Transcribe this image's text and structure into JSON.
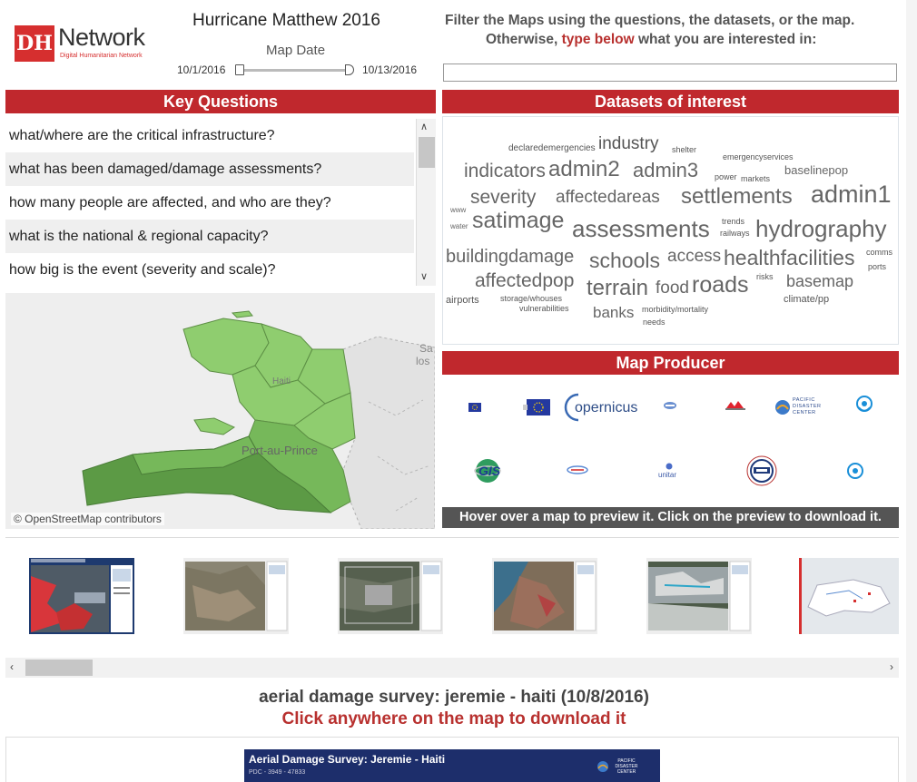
{
  "logo": {
    "mark": "DH",
    "name": "Network",
    "tagline": "Digital Humanitarian Network"
  },
  "header": {
    "title": "Hurricane Matthew 2016",
    "map_date_label": "Map Date",
    "date_start": "10/1/2016",
    "date_end": "10/13/2016"
  },
  "filter": {
    "line1": "Filter the Maps using the questions, the datasets, or the map.",
    "line2_pre": "Otherwise,",
    "line2_highlight": "type below",
    "line2_post": "what you are interested in:",
    "input_value": ""
  },
  "key_questions": {
    "title": "Key Questions",
    "items": [
      "what/where are the critical infrastructure?",
      "what has been damaged/damage assessments?",
      "how many people are affected, and who are they?",
      "what is the national & regional capacity?",
      "how big is the event (severity and scale)?"
    ]
  },
  "map": {
    "labels": {
      "country": "Haiti",
      "city": "Port-au-Prince",
      "edge1": "Sa",
      "edge2": "los"
    },
    "credit": "© OpenStreetMap contributors",
    "colors": {
      "light": "#8fcd6f",
      "mid": "#76b85a",
      "dark": "#5c9a45",
      "land": "#e2e2e2",
      "sea": "#eeeeee"
    }
  },
  "datasets": {
    "title": "Datasets of interest",
    "words": [
      {
        "text": "declaredemergencies"
      },
      {
        "text": "industry"
      },
      {
        "text": "shelter"
      },
      {
        "text": "emergencyservices"
      },
      {
        "text": "indicators"
      },
      {
        "text": "admin2"
      },
      {
        "text": "admin3"
      },
      {
        "text": "power"
      },
      {
        "text": "markets"
      },
      {
        "text": "baselinepop"
      },
      {
        "text": "severity"
      },
      {
        "text": "affectedareas"
      },
      {
        "text": "settlements"
      },
      {
        "text": "admin1"
      },
      {
        "text": "www"
      },
      {
        "text": "water"
      },
      {
        "text": "satimage"
      },
      {
        "text": "assessments"
      },
      {
        "text": "trends"
      },
      {
        "text": "railways"
      },
      {
        "text": "hydrography"
      },
      {
        "text": "buildingdamage"
      },
      {
        "text": "schools"
      },
      {
        "text": "access"
      },
      {
        "text": "healthfacilities"
      },
      {
        "text": "comms"
      },
      {
        "text": "ports"
      },
      {
        "text": "affectedpop"
      },
      {
        "text": "terrain"
      },
      {
        "text": "food"
      },
      {
        "text": "roads"
      },
      {
        "text": "risks"
      },
      {
        "text": "basemap"
      },
      {
        "text": "airports"
      },
      {
        "text": "storage/whouses"
      },
      {
        "text": "vulnerabilities"
      },
      {
        "text": "banks"
      },
      {
        "text": "morbidity/mortality"
      },
      {
        "text": "needs"
      },
      {
        "text": "climate/pp"
      }
    ]
  },
  "map_producer": {
    "title": "Map Producer",
    "logos": [
      {
        "name": "eu-flag-small"
      },
      {
        "name": "eu-flag"
      },
      {
        "name": "copernicus",
        "text": "opernicus"
      },
      {
        "name": "unosat-small"
      },
      {
        "name": "msf"
      },
      {
        "name": "pacific-disaster-center",
        "text": "PACIFIC DISASTER CENTER"
      },
      {
        "name": "wfp"
      },
      {
        "name": "gis",
        "text": "GIS"
      },
      {
        "name": "mapaction-small"
      },
      {
        "name": "unitar",
        "text": "unitar"
      },
      {
        "name": "usaid"
      },
      {
        "name": "wfp-2"
      }
    ],
    "footer": "Hover over a map to preview it. Click on the preview to download it."
  },
  "thumbnails": [
    {
      "name": "thumb-jeremie-aerial"
    },
    {
      "name": "thumb-satellite-1"
    },
    {
      "name": "thumb-satellite-2"
    },
    {
      "name": "thumb-coast"
    },
    {
      "name": "thumb-cloud-satellite"
    },
    {
      "name": "thumb-haiti-map"
    }
  ],
  "selected": {
    "title": "aerial damage survey: jeremie - haiti (10/8/2016)",
    "link": "Click anywhere on the map to download it",
    "preview_title": "Aerial Damage Survey: Jeremie - Haiti",
    "preview_sub": "PDC - 3949 - 47833",
    "preview_logo": "PACIFIC DISASTER CENTER"
  },
  "colors": {
    "accent": "#c0282d",
    "highlight": "#b8312f",
    "footer_bg": "#555555"
  }
}
